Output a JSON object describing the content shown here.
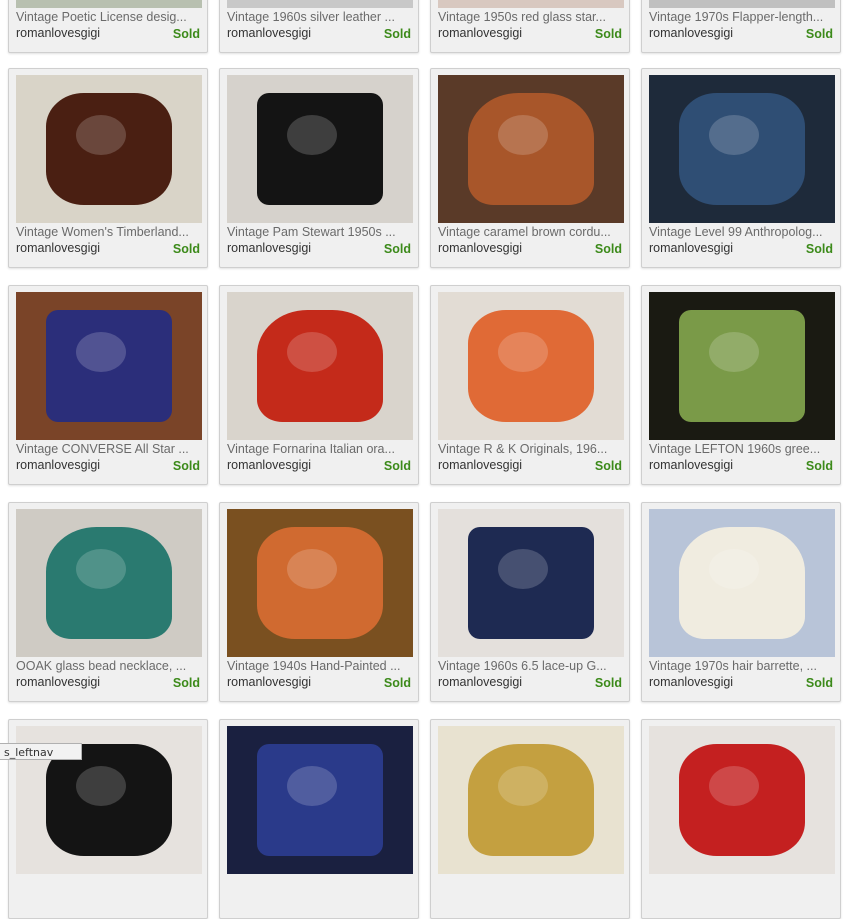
{
  "listings": [
    {
      "title": "Vintage Poetic License desig...",
      "seller": "romanlovesgigi",
      "status": "Sold",
      "thumb": "thumb-1",
      "bg": "#b8c0b0",
      "fg": "#3a3a3a"
    },
    {
      "title": "Vintage 1960s silver leather ...",
      "seller": "romanlovesgigi",
      "status": "Sold",
      "thumb": "thumb-2",
      "bg": "#c8c8c8",
      "fg": "#7a7a7a"
    },
    {
      "title": "Vintage 1950s red glass star...",
      "seller": "romanlovesgigi",
      "status": "Sold",
      "thumb": "thumb-3",
      "bg": "#d8c8c0",
      "fg": "#b03020"
    },
    {
      "title": "Vintage 1970s Flapper-length...",
      "seller": "romanlovesgigi",
      "status": "Sold",
      "thumb": "thumb-4",
      "bg": "#c0c0c0",
      "fg": "#505050"
    },
    {
      "title": "Vintage Women's Timberland...",
      "seller": "romanlovesgigi",
      "status": "Sold",
      "thumb": "shoes-brown-icon",
      "bg": "#d9d4c8",
      "fg": "#4a1f12"
    },
    {
      "title": "Vintage Pam Stewart 1950s ...",
      "seller": "romanlovesgigi",
      "status": "Sold",
      "thumb": "black-sweater-icon",
      "bg": "#d6d2cc",
      "fg": "#141414"
    },
    {
      "title": "Vintage caramel brown cordu...",
      "seller": "romanlovesgigi",
      "status": "Sold",
      "thumb": "brown-vest-icon",
      "bg": "#5a3a28",
      "fg": "#a8562a"
    },
    {
      "title": "Vintage Level 99 Anthropolog...",
      "seller": "romanlovesgigi",
      "status": "Sold",
      "thumb": "denim-jacket-icon",
      "bg": "#1e2a3a",
      "fg": "#2f4e74"
    },
    {
      "title": "Vintage CONVERSE All Star ...",
      "seller": "romanlovesgigi",
      "status": "Sold",
      "thumb": "patterned-sneakers-icon",
      "bg": "#7a4428",
      "fg": "#2b2e7a"
    },
    {
      "title": "Vintage Fornarina Italian ora...",
      "seller": "romanlovesgigi",
      "status": "Sold",
      "thumb": "red-slippers-icon",
      "bg": "#d9d4cc",
      "fg": "#c42a1a"
    },
    {
      "title": "Vintage R & K Originals, 196...",
      "seller": "romanlovesgigi",
      "status": "Sold",
      "thumb": "orange-dress-icon",
      "bg": "#e2dcd4",
      "fg": "#e06a36"
    },
    {
      "title": "Vintage LEFTON 1960s gree...",
      "seller": "romanlovesgigi",
      "status": "Sold",
      "thumb": "green-figurine-icon",
      "bg": "#1a1a12",
      "fg": "#7a9a48"
    },
    {
      "title": "OOAK glass bead necklace, ...",
      "seller": "romanlovesgigi",
      "status": "Sold",
      "thumb": "bead-necklace-icon",
      "bg": "#cfcbc4",
      "fg": "#2a7a70"
    },
    {
      "title": "Vintage 1940s Hand-Painted ...",
      "seller": "romanlovesgigi",
      "status": "Sold",
      "thumb": "salt-shakers-icon",
      "bg": "#7a5020",
      "fg": "#d06a30"
    },
    {
      "title": "Vintage 1960s 6.5 lace-up G...",
      "seller": "romanlovesgigi",
      "status": "Sold",
      "thumb": "navy-boot-icon",
      "bg": "#e4e0dc",
      "fg": "#1e2a52"
    },
    {
      "title": "Vintage 1970s hair barrette, ...",
      "seller": "romanlovesgigi",
      "status": "Sold",
      "thumb": "flower-barrette-icon",
      "bg": "#b8c4d8",
      "fg": "#f0ece0"
    },
    {
      "title": "",
      "seller": "",
      "status": "",
      "thumb": "thumb-17",
      "bg": "#e6e2de",
      "fg": "#141414"
    },
    {
      "title": "",
      "seller": "",
      "status": "",
      "thumb": "thumb-18",
      "bg": "#1a2040",
      "fg": "#2a3a8a"
    },
    {
      "title": "",
      "seller": "",
      "status": "",
      "thumb": "thumb-19",
      "bg": "#e8e2d0",
      "fg": "#c4a040"
    },
    {
      "title": "",
      "seller": "",
      "status": "",
      "thumb": "thumb-20",
      "bg": "#e6e2de",
      "fg": "#c42020"
    }
  ],
  "status_tip": "s_leftnav"
}
